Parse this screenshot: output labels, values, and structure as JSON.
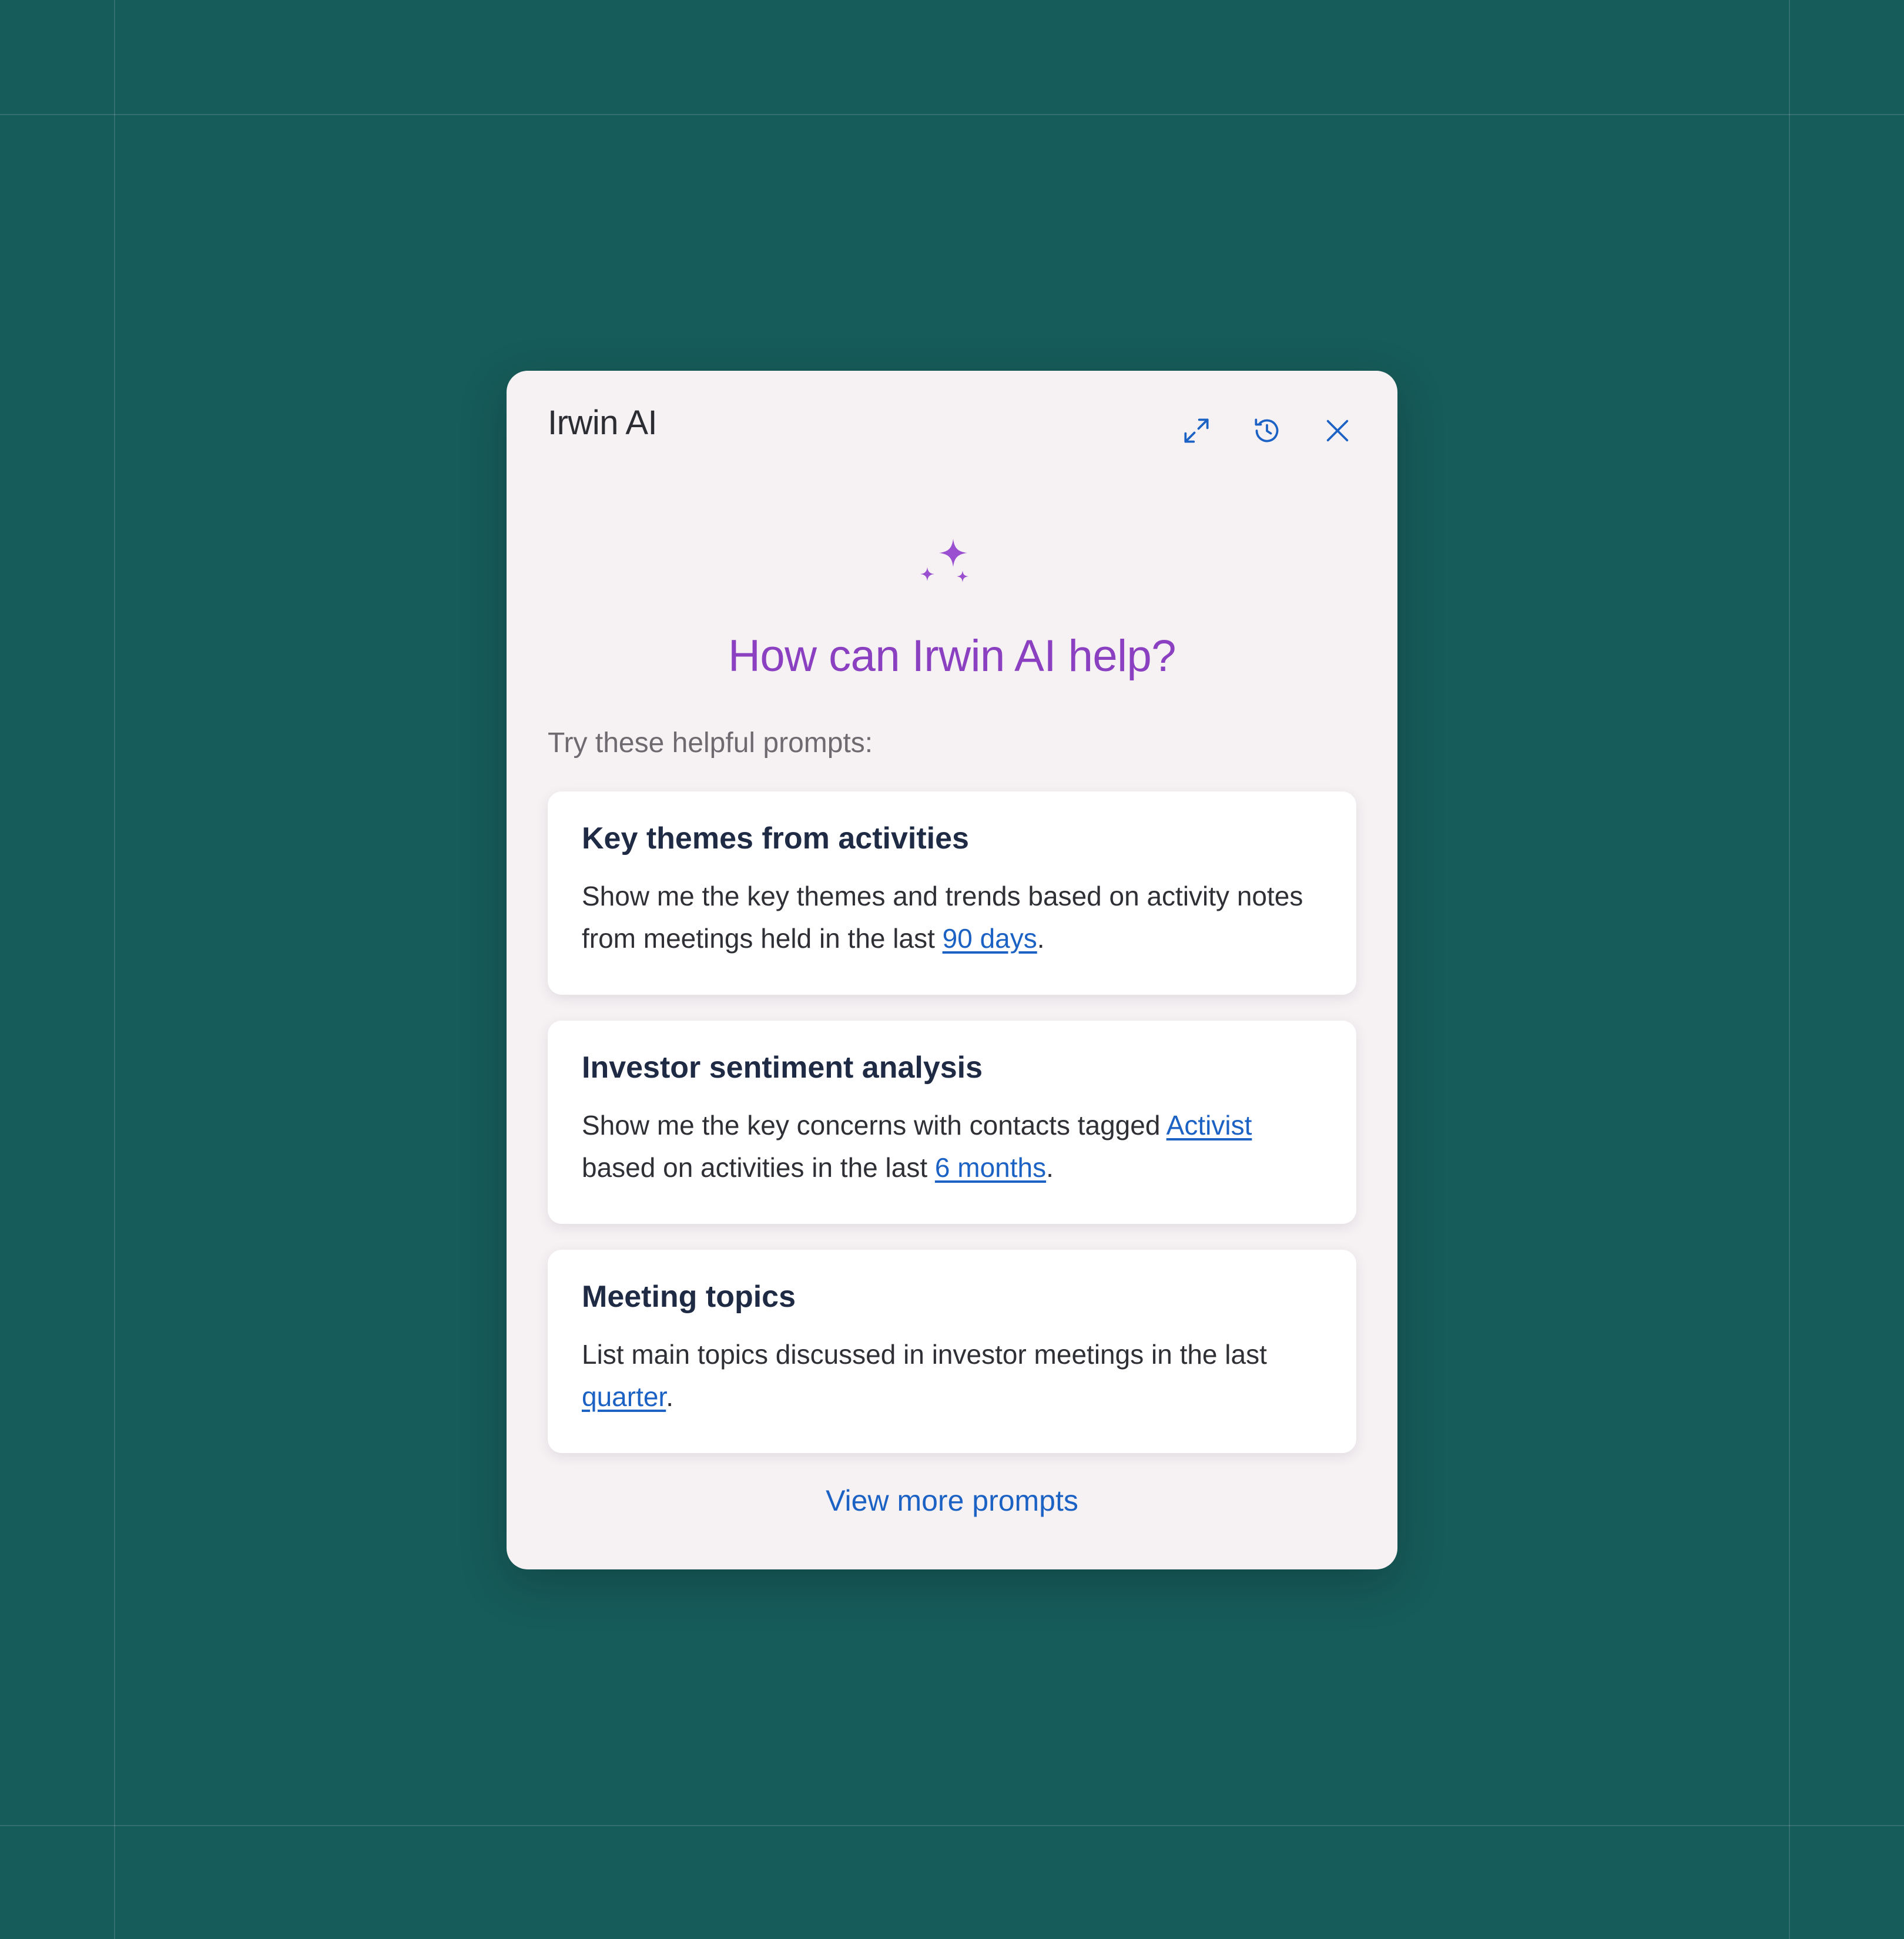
{
  "panel": {
    "title": "Irwin AI",
    "actions": {
      "expand_icon": "expand-icon",
      "history_icon": "history-icon",
      "close_icon": "close-icon"
    }
  },
  "hero": {
    "sparkle_icon": "sparkle-icon",
    "title": "How can Irwin AI help?"
  },
  "prompts": {
    "label": "Try these helpful prompts:",
    "cards": [
      {
        "title": "Key themes from activities",
        "text1": "Show me the key themes and trends based on activity notes from meetings held in the last ",
        "link1": "90 days",
        "text2": "."
      },
      {
        "title": "Investor sentiment analysis",
        "text1": "Show me the key concerns with contacts tagged ",
        "link1": "Activist",
        "text2": " based on activities in the last ",
        "link2": "6 months",
        "text3": "."
      },
      {
        "title": "Meeting topics",
        "text1": "List main topics discussed in investor meetings in the last ",
        "link1": "quarter",
        "text2": "."
      }
    ],
    "view_more": "View more prompts"
  },
  "colors": {
    "background": "#165c5a",
    "panel": "#f6f2f4",
    "accent_purple": "#8a40c0",
    "link_blue": "#1b62c4",
    "heading_navy": "#1f2a44"
  }
}
